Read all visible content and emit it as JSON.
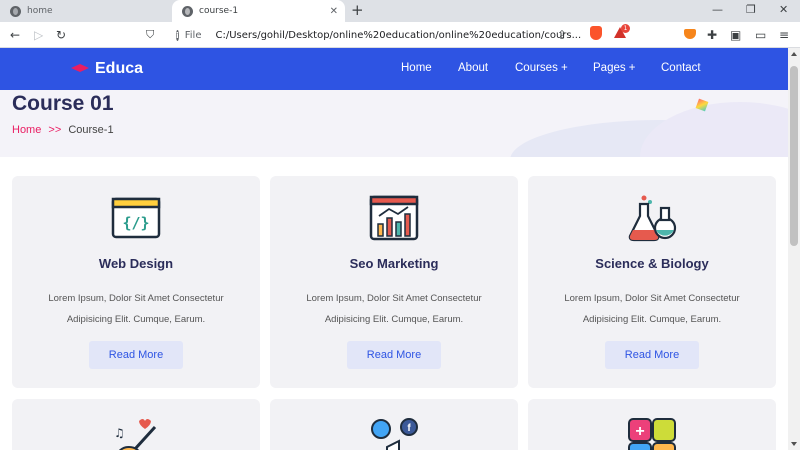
{
  "browser": {
    "tabs": [
      {
        "title": "home",
        "active": false
      },
      {
        "title": "course-1",
        "active": true
      }
    ],
    "new_tab": "+",
    "url": "C:/Users/gohil/Desktop/online%20education/online%20education/cours...",
    "url_scheme_label": "File",
    "window_controls": {
      "minimize": "—",
      "restore": "❐",
      "close": "✕"
    },
    "toolbar_icons": {
      "back": "←",
      "forward": "▷",
      "reload": "↻",
      "bookmark": "🔖",
      "share": "⇪",
      "menu": "≡"
    },
    "brave_badge": "1",
    "colors": {
      "tabbar": "#dee1e6"
    }
  },
  "site": {
    "logo": "Educa",
    "nav": [
      "Home",
      "About",
      "Courses +",
      "Pages +",
      "Contact"
    ],
    "colors": {
      "header": "#2e54e3",
      "accent": "#e91e63",
      "title": "#2b2d5a"
    }
  },
  "hero": {
    "title": "Course 01",
    "breadcrumb_home": "Home",
    "breadcrumb_sep": ">>",
    "breadcrumb_current": "Course-1"
  },
  "courses": [
    {
      "title": "Web Design",
      "line1": "Lorem Ipsum, Dolor Sit Amet Consectetur",
      "line2": "Adipisicing Elit. Cumque, Earum.",
      "button": "Read More",
      "icon": "code-window-icon"
    },
    {
      "title": "Seo Marketing",
      "line1": "Lorem Ipsum, Dolor Sit Amet Consectetur",
      "line2": "Adipisicing Elit. Cumque, Earum.",
      "button": "Read More",
      "icon": "analytics-chart-icon"
    },
    {
      "title": "Science & Biology",
      "line1": "Lorem Ipsum, Dolor Sit Amet Consectetur",
      "line2": "Adipisicing Elit. Cumque, Earum.",
      "button": "Read More",
      "icon": "flask-icon"
    }
  ],
  "courses_row2_icons": [
    "guitar-music-icon",
    "social-media-icon",
    "math-calculator-icon"
  ]
}
